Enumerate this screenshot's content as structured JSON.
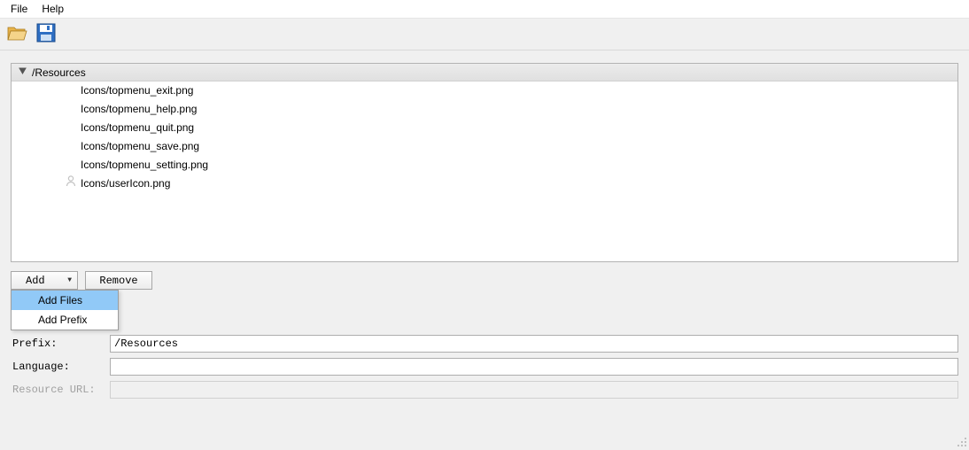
{
  "menubar": {
    "file": "File",
    "help": "Help"
  },
  "toolbar": {
    "open_icon": "folder-open-icon",
    "save_icon": "save-icon"
  },
  "tree": {
    "root": "/Resources",
    "items": [
      "Icons/topmenu_exit.png",
      "Icons/topmenu_help.png",
      "Icons/topmenu_quit.png",
      "Icons/topmenu_save.png",
      "Icons/topmenu_setting.png",
      "Icons/userIcon.png"
    ]
  },
  "buttons": {
    "add": "Add",
    "remove": "Remove"
  },
  "dropdown": {
    "add_files": "Add Files",
    "add_prefix": "Add Prefix"
  },
  "form": {
    "prefix_label": "Prefix:",
    "prefix_value": "/Resources",
    "language_label": "Language:",
    "language_value": "",
    "resource_url_label": "Resource URL:",
    "resource_url_value": ""
  }
}
